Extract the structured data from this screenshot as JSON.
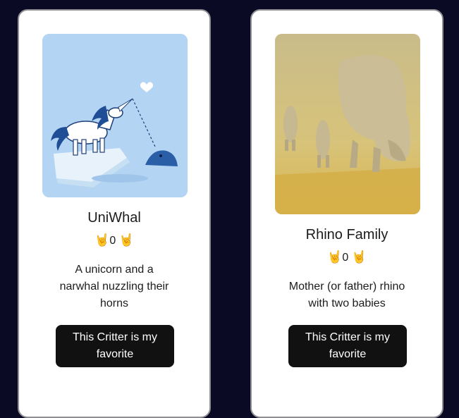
{
  "critters": [
    {
      "name": "UniWhal",
      "likes": "0",
      "like_icon_left": "🤘",
      "like_icon_right": "🤘",
      "description": "A unicorn and a narwhal nuzzling their horns",
      "favorite_label": "This Critter is my favorite",
      "image_icon": "unicorn-narwhal-image"
    },
    {
      "name": "Rhino Family",
      "likes": "0",
      "like_icon_left": "🤘",
      "like_icon_right": "🤘",
      "description": "Mother (or father) rhino with two babies",
      "favorite_label": "This Critter is my favorite",
      "image_icon": "rhino-family-photo"
    }
  ],
  "colors": {
    "page_background": "#0b0a24",
    "card_background": "#ffffff",
    "button_background": "#111111",
    "button_text": "#ffffff"
  }
}
